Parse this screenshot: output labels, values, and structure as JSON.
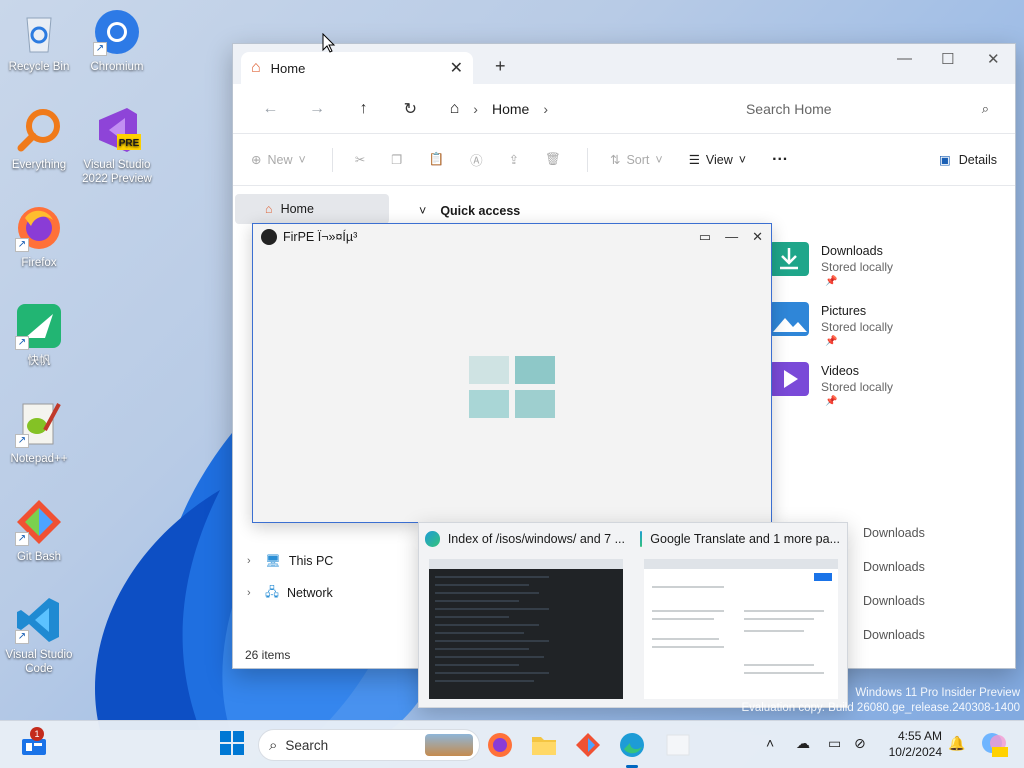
{
  "desktop": {
    "icons": [
      {
        "label": "Recycle Bin",
        "icon": "recycle-bin-icon"
      },
      {
        "label": "Chromium",
        "icon": "chromium-icon"
      },
      {
        "label": "Everything",
        "icon": "everything-search-icon"
      },
      {
        "label": "Visual Studio 2022 Preview",
        "icon": "visual-studio-preview-icon",
        "badge": "PRE"
      },
      {
        "label": "Firefox",
        "icon": "firefox-icon"
      },
      {
        "label": "快帆",
        "icon": "kuaifan-icon"
      },
      {
        "label": "Notepad++",
        "icon": "notepad-plus-plus-icon"
      },
      {
        "label": "Git Bash",
        "icon": "git-bash-icon"
      },
      {
        "label": "Visual Studio Code",
        "icon": "vscode-icon"
      }
    ]
  },
  "explorer": {
    "tab_label": "Home",
    "new_tab": "+",
    "breadcrumb": {
      "location": "Home"
    },
    "search_placeholder": "Search Home",
    "toolbar": {
      "new_label": "New",
      "sort_label": "Sort",
      "view_label": "View",
      "more_label": "···",
      "details_label": "Details"
    },
    "sidebar": {
      "home": "Home",
      "this_pc": "This PC",
      "network": "Network"
    },
    "quick_access_label": "Quick access",
    "folders": [
      {
        "name": "Downloads",
        "sub": "Stored locally",
        "color": "#1fa68a"
      },
      {
        "name": "Pictures",
        "sub": "Stored locally",
        "color": "#2f86d8"
      },
      {
        "name": "Videos",
        "sub": "Stored locally",
        "color": "#7a4ad8"
      }
    ],
    "recent_locations": [
      "Downloads",
      "Downloads",
      "Downloads",
      "Downloads"
    ],
    "status": "26 items"
  },
  "firpe": {
    "title": "FirPE Ï¬»¤Íµ³"
  },
  "preview": {
    "items": [
      {
        "title": "Index of /isos/windows/ and 7 ..."
      },
      {
        "title": "Google Translate and 1 more pa..."
      }
    ]
  },
  "watermark": {
    "line1": "Windows 11 Pro Insider Preview",
    "line2": "Evaluation copy. Build 26080.ge_release.240308-1400"
  },
  "taskbar": {
    "search_label": "Search",
    "widgets_badge": "1",
    "time": "4:55 AM",
    "date": "10/2/2024"
  },
  "colors": {
    "accent": "#0067c0",
    "firpe_tile": "#8ec8c8",
    "folder_downloads": "#1fa68a"
  }
}
